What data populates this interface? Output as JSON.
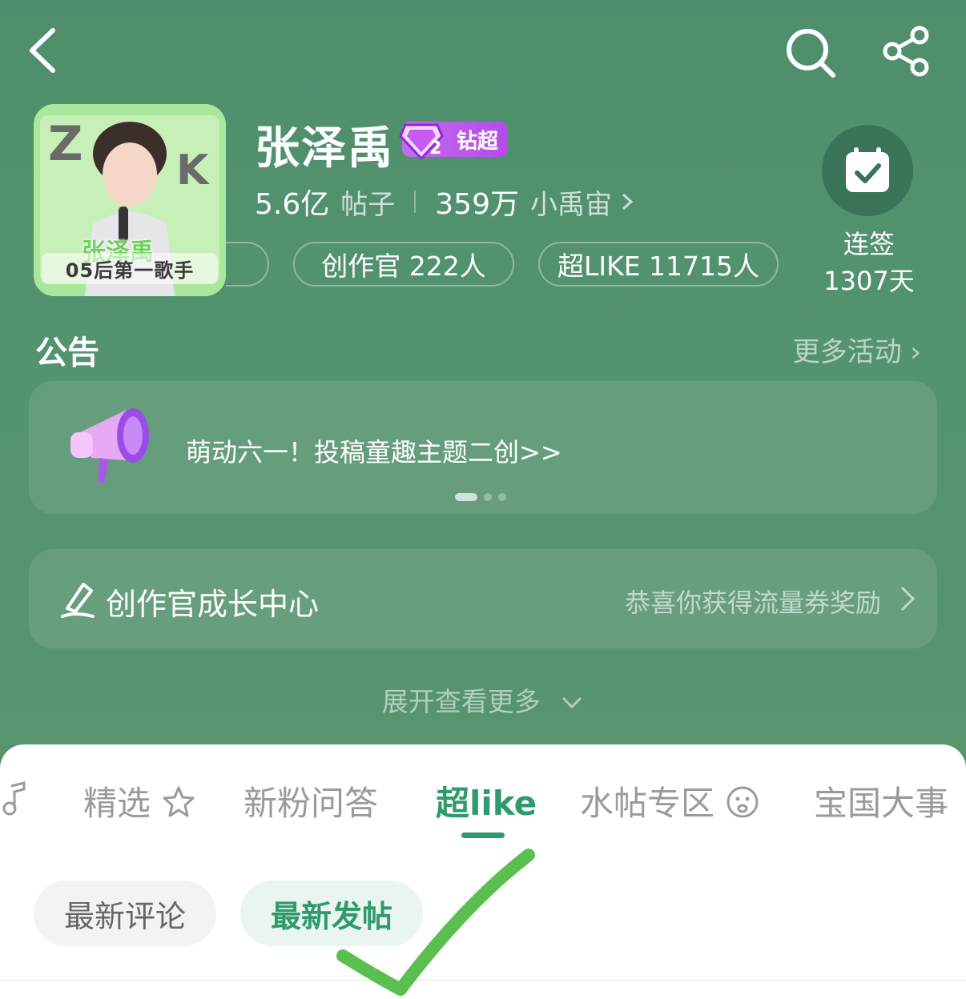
{
  "nav": {
    "back_icon": "back-arrow-icon",
    "search_icon": "search-icon",
    "share_icon": "share-icon"
  },
  "topic": {
    "avatar_caption": "05后第一歌手",
    "avatar_name": "张泽禹",
    "title": "张泽禹",
    "badge_label": "钻超",
    "badge_level": "2",
    "posts_count": "5.6亿",
    "posts_label": "帖子",
    "fans_count": "359万",
    "fans_label": "小禹宙",
    "chips": [
      "创作官 222人",
      "超LIKE 11715人"
    ]
  },
  "checkin": {
    "label": "连签",
    "days": "1307天"
  },
  "notice": {
    "title": "公告",
    "more": "更多活动 ›",
    "text": "萌动六一！投稿童趣主题二创>>"
  },
  "growth": {
    "title": "创作官成长中心",
    "right": "恭喜你获得流量券奖励"
  },
  "expand": "展开查看更多",
  "tabs": [
    "精选",
    "新粉问答",
    "超like",
    "水帖专区",
    "宝国大事"
  ],
  "active_tab": "超like",
  "subtabs": [
    "最新评论",
    "最新发帖"
  ],
  "active_subtab": "最新发帖",
  "colors": {
    "bg_green": "#4f8e6c",
    "accent_green": "#2f9a6c",
    "badge_purple": "#b44be9",
    "check_mark": "#5bbf4f"
  }
}
